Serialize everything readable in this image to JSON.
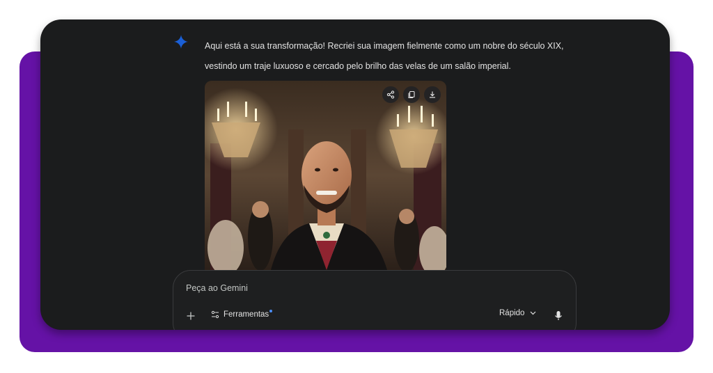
{
  "assistant": {
    "message": "Aqui está a sua transformação! Recriei sua imagem fielmente como um nobre do século XIX, vestindo um traje luxuoso e cercado pelo brilho das velas de um salão imperial.",
    "icon": "gemini-sparkle-icon"
  },
  "image": {
    "actions": [
      {
        "icon": "share-icon"
      },
      {
        "icon": "copy-icon"
      },
      {
        "icon": "download-icon"
      }
    ]
  },
  "composer": {
    "placeholder": "Peça ao Gemini",
    "tools_label": "Ferramentas",
    "mode_label": "Rápido"
  },
  "colors": {
    "background_accent": "#6512a6",
    "window": "#1b1c1d",
    "text": "#e3e3e3",
    "gemini_blue": "#1a5fd6"
  }
}
